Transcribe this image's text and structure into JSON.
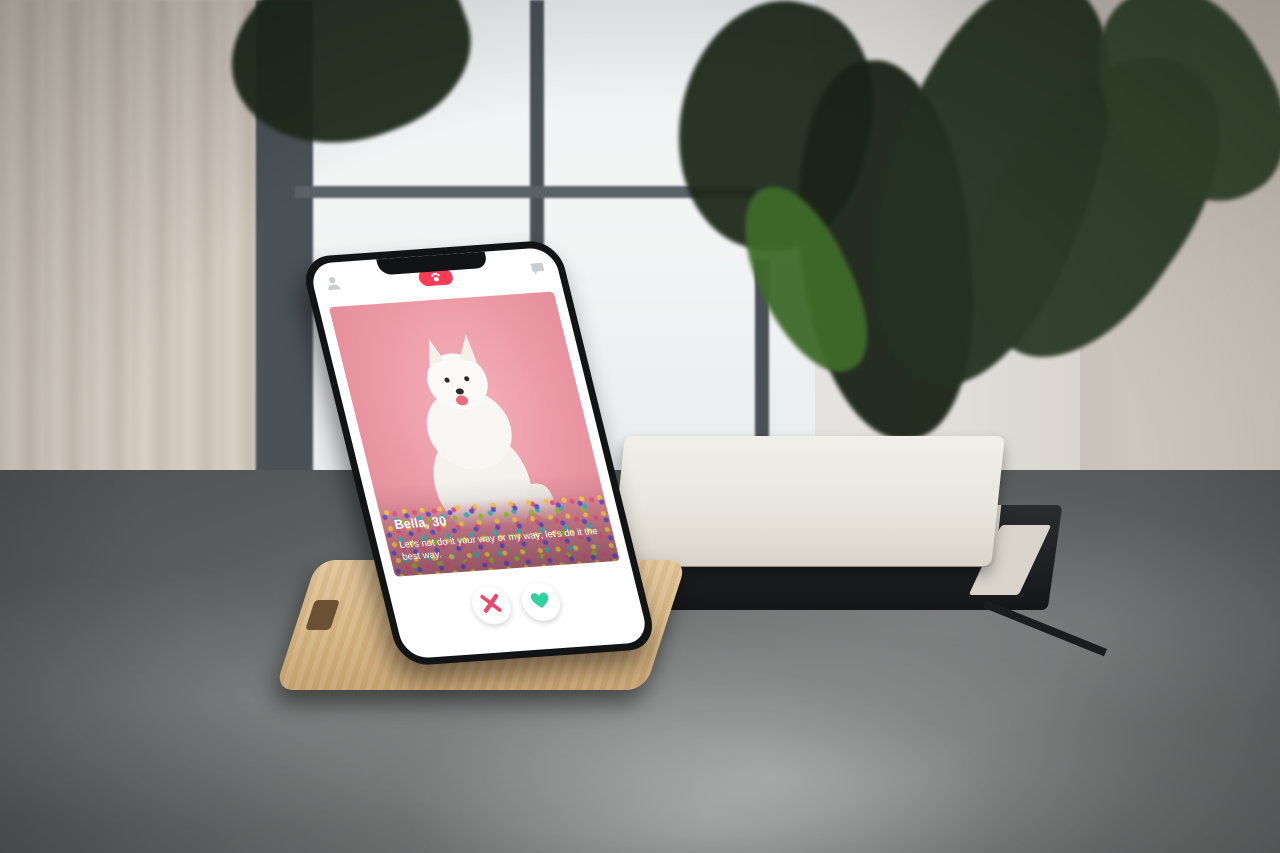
{
  "scene": {
    "description_tag": "phone-on-wooden-stand",
    "colors": {
      "brand_accent": "#ff3b58",
      "like": "#2fd1a0",
      "dislike": "#f0486a",
      "card_background": "#ec98a5"
    }
  },
  "app": {
    "header": {
      "left_icon": "profile-icon",
      "center_icon": "paw-logo-icon",
      "right_icon": "chat-icon"
    },
    "card": {
      "name_age": "Bella, 30",
      "bio": "Let's not do it your way or my way; let's do it the best way."
    },
    "actions": {
      "dislike_icon": "close-x-icon",
      "like_icon": "heart-icon"
    }
  }
}
